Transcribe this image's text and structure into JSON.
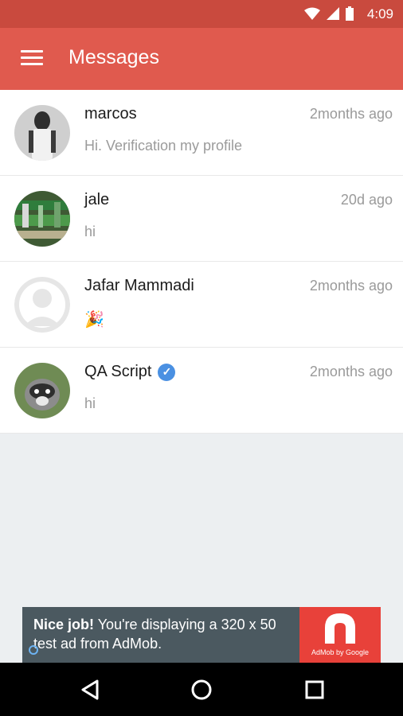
{
  "status_bar": {
    "time": "4:09",
    "icons": [
      "wifi-icon",
      "signal-icon",
      "battery-icon"
    ]
  },
  "app_bar": {
    "title": "Messages",
    "menu_icon": "hamburger-icon"
  },
  "conversations": [
    {
      "name": "marcos",
      "time": "2months ago",
      "preview": "Hi. Verification my profile",
      "verified": false
    },
    {
      "name": "jale",
      "time": "20d ago",
      "preview": "hi",
      "verified": false
    },
    {
      "name": "Jafar Mammadi",
      "time": "2months ago",
      "preview": "🎉",
      "verified": false
    },
    {
      "name": "QA Script",
      "time": "2months ago",
      "preview": "hi",
      "verified": true
    }
  ],
  "ad": {
    "headline": "Nice job!",
    "body": "You're displaying a 320 x 50 test ad from AdMob.",
    "brand": "AdMob by Google"
  },
  "nav": [
    "back-icon",
    "home-icon",
    "recents-icon"
  ],
  "colors": {
    "status_bar": "#c94a3e",
    "app_bar": "#e05a4e",
    "ad_background": "#4b5960",
    "ad_logo": "#e8413a",
    "verified": "#4a90e2"
  }
}
